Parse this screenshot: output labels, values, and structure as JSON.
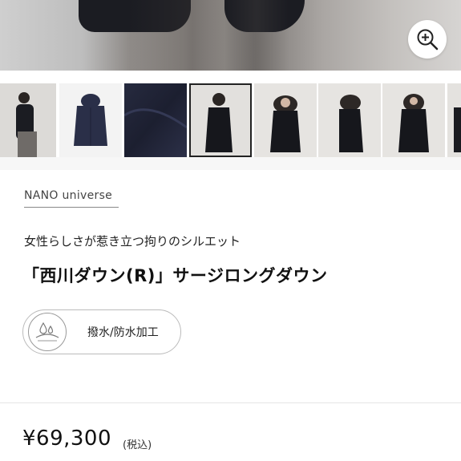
{
  "gallery": {
    "thumbnails": [
      {
        "alt": "model-side-view"
      },
      {
        "alt": "coat-front-flat"
      },
      {
        "alt": "fabric-closeup"
      },
      {
        "alt": "model-front-hood"
      },
      {
        "alt": "model-front-fur-hood"
      },
      {
        "alt": "model-side-fur-hood"
      },
      {
        "alt": "model-front-standing"
      }
    ],
    "selected_index": 3
  },
  "product": {
    "brand": "NANO universe",
    "subtitle": "女性らしさが惹き立つ拘りのシルエット",
    "title": "「西川ダウン(R)」サージロングダウン",
    "feature_label": "撥水/防水加工",
    "price": "¥69,300",
    "tax_note": "(税込)"
  },
  "icons": {
    "zoom": "zoom-in-icon",
    "feature": "water-repellent-icon"
  },
  "colors": {
    "coat": "#1b1c22",
    "navy_coat": "#2a2f48",
    "text": "#222222"
  }
}
